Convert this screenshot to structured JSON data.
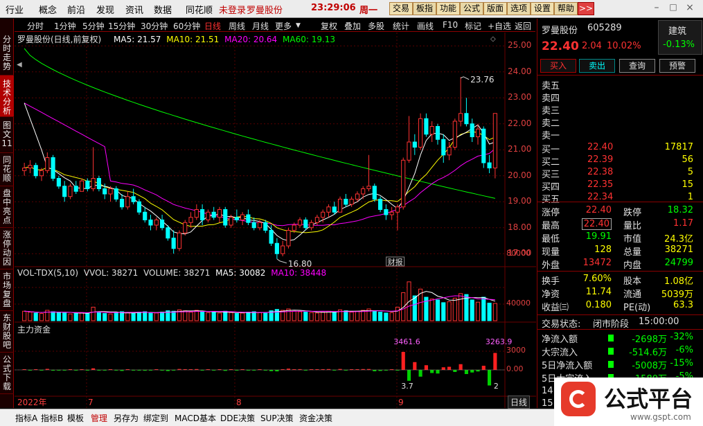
{
  "menu": {
    "items": [
      "行业",
      "概念",
      "前沿",
      "发现",
      "资讯",
      "数据",
      "同花顺"
    ],
    "login": "未登录",
    "stock": "罗曼股份",
    "time": "23:29:06",
    "weekday": "周一"
  },
  "win_buttons": [
    "交易",
    "板指",
    "功能",
    "公式",
    "版面",
    "选项",
    "设置",
    "帮助"
  ],
  "chart_toolbar": {
    "left": [
      "分时",
      "1分钟",
      "5分钟",
      "15分钟",
      "30分钟",
      "60分钟",
      "日线",
      "周线",
      "月线",
      "更多"
    ],
    "right": [
      "复权",
      "叠加",
      "多股",
      "统计",
      "画线",
      "F10",
      "标记",
      "+自选",
      "返回"
    ],
    "active": "日线"
  },
  "left_tabs": [
    "分时走势",
    "技术分析",
    "图文11",
    "同花顺",
    "盘中亮点",
    "涨停动因",
    "市场复盘",
    "东财股吧",
    "公式下载"
  ],
  "chart": {
    "header_name": "罗曼股份(日线,前复权)",
    "ma5": "MA5: 21.57",
    "ma10": "MA10: 21.51",
    "ma20": "MA20: 20.64",
    "ma60": "MA60: 19.13",
    "high_label": "23.76",
    "low_label": "16.80",
    "event_label": "财报",
    "vol_header": "VOL-TDX(5,10)",
    "vol_vvol": "VVOL: 38271",
    "vol_volume": "VOLUME: 38271",
    "vol_ma5": "MA5: 30082",
    "vol_ma10": "MA10: 38448",
    "zl_header": "主力资金",
    "zl_pos": "3461.6",
    "zl_pos2": "3263.9",
    "zl_neg": "3.7",
    "zl_neg2": "2",
    "dates": [
      "2022年",
      "7",
      "8",
      "9"
    ],
    "period_btn": "日线"
  },
  "chart_data": {
    "type": "candlestick",
    "title": "罗曼股份(日线,前复权)",
    "y_ticks": [
      "25.00",
      "24.00",
      "23.00",
      "22.00",
      "21.00",
      "20.00",
      "19.00",
      "18.00",
      "17.00"
    ],
    "vol_ticks": [
      "80000",
      "40000"
    ],
    "zl_ticks": [
      "3000",
      "0.00"
    ],
    "ylim": [
      16.5,
      25.3
    ],
    "ohlc": [
      [
        20.2,
        20.5,
        20.0,
        20.3
      ],
      [
        20.3,
        20.6,
        20.1,
        20.4
      ],
      [
        20.4,
        20.5,
        19.9,
        20.0
      ],
      [
        20.0,
        20.3,
        19.8,
        20.2
      ],
      [
        20.2,
        20.9,
        20.1,
        20.7
      ],
      [
        20.7,
        20.8,
        19.8,
        19.9
      ],
      [
        19.9,
        20.0,
        19.5,
        19.6
      ],
      [
        19.6,
        19.8,
        19.0,
        19.2
      ],
      [
        19.2,
        19.7,
        19.1,
        19.6
      ],
      [
        19.6,
        19.8,
        19.3,
        19.4
      ],
      [
        19.4,
        19.9,
        19.4,
        19.8
      ],
      [
        19.8,
        19.9,
        19.4,
        19.5
      ],
      [
        19.5,
        21.1,
        19.4,
        19.9
      ],
      [
        19.9,
        20.0,
        19.4,
        19.5
      ],
      [
        19.5,
        19.7,
        19.1,
        19.3
      ],
      [
        19.3,
        19.6,
        19.0,
        19.5
      ],
      [
        19.5,
        19.6,
        19.0,
        19.1
      ],
      [
        19.1,
        19.3,
        18.7,
        18.8
      ],
      [
        18.8,
        19.4,
        18.7,
        19.2
      ],
      [
        19.2,
        19.5,
        18.9,
        19.0
      ],
      [
        19.0,
        19.1,
        18.5,
        18.6
      ],
      [
        18.6,
        18.8,
        18.2,
        18.3
      ],
      [
        18.3,
        18.5,
        17.9,
        18.1
      ],
      [
        18.1,
        18.4,
        17.9,
        18.3
      ],
      [
        18.3,
        18.5,
        17.9,
        18.0
      ],
      [
        18.0,
        18.1,
        17.5,
        17.6
      ],
      [
        17.6,
        17.9,
        17.0,
        17.2
      ],
      [
        17.2,
        17.9,
        17.1,
        17.8
      ],
      [
        17.8,
        18.3,
        17.7,
        18.2
      ],
      [
        18.2,
        18.6,
        18.0,
        18.4
      ],
      [
        18.4,
        18.9,
        18.3,
        18.7
      ],
      [
        18.7,
        18.9,
        18.1,
        18.3
      ],
      [
        18.3,
        18.7,
        18.2,
        18.6
      ],
      [
        18.6,
        18.8,
        18.3,
        18.4
      ],
      [
        18.4,
        18.8,
        18.2,
        18.7
      ],
      [
        18.7,
        18.8,
        18.0,
        18.1
      ],
      [
        18.1,
        18.5,
        18.0,
        18.4
      ],
      [
        18.4,
        18.7,
        18.2,
        18.3
      ],
      [
        18.3,
        18.6,
        18.1,
        18.5
      ],
      [
        18.5,
        18.7,
        18.1,
        18.2
      ],
      [
        18.2,
        18.4,
        17.9,
        18.0
      ],
      [
        18.0,
        18.3,
        17.9,
        18.2
      ],
      [
        18.2,
        18.3,
        17.8,
        17.9
      ],
      [
        17.9,
        18.1,
        17.3,
        17.4
      ],
      [
        17.4,
        17.6,
        16.8,
        17.0
      ],
      [
        17.0,
        17.5,
        16.9,
        17.3
      ],
      [
        17.3,
        18.0,
        17.2,
        17.9
      ],
      [
        17.9,
        18.2,
        17.8,
        18.1
      ],
      [
        18.1,
        18.4,
        18.0,
        18.3
      ],
      [
        18.3,
        18.4,
        17.9,
        18.0
      ],
      [
        18.0,
        18.3,
        17.9,
        18.2
      ],
      [
        18.2,
        18.5,
        18.1,
        18.4
      ],
      [
        18.4,
        18.7,
        18.2,
        18.6
      ],
      [
        18.6,
        18.9,
        18.4,
        18.8
      ],
      [
        18.8,
        19.0,
        18.5,
        18.6
      ],
      [
        18.6,
        19.2,
        18.6,
        19.1
      ],
      [
        19.1,
        19.3,
        18.8,
        18.9
      ],
      [
        18.9,
        19.2,
        18.8,
        19.1
      ],
      [
        19.1,
        19.4,
        19.0,
        19.3
      ],
      [
        19.3,
        19.6,
        19.1,
        19.5
      ],
      [
        19.5,
        20.8,
        19.4,
        19.6
      ],
      [
        19.6,
        19.7,
        19.0,
        19.1
      ],
      [
        19.1,
        19.2,
        18.6,
        18.7
      ],
      [
        18.7,
        18.9,
        18.3,
        18.5
      ],
      [
        18.5,
        18.8,
        18.3,
        18.6
      ],
      [
        18.6,
        18.9,
        17.9,
        18.8
      ],
      [
        18.8,
        20.7,
        18.7,
        20.6
      ],
      [
        20.6,
        22.3,
        20.5,
        21.3
      ],
      [
        21.3,
        21.6,
        20.8,
        21.1
      ],
      [
        21.1,
        22.4,
        21.0,
        22.2
      ],
      [
        22.2,
        22.4,
        21.5,
        21.6
      ],
      [
        21.6,
        22.1,
        21.3,
        21.9
      ],
      [
        21.9,
        22.0,
        21.2,
        21.4
      ],
      [
        21.4,
        21.6,
        20.5,
        20.8
      ],
      [
        20.8,
        21.3,
        20.6,
        21.1
      ],
      [
        21.1,
        22.2,
        21.0,
        22.1
      ],
      [
        22.1,
        23.8,
        21.9,
        22.4
      ],
      [
        22.4,
        23.0,
        21.9,
        22.0
      ],
      [
        22.0,
        22.2,
        21.3,
        21.5
      ],
      [
        21.5,
        22.0,
        21.2,
        21.8
      ],
      [
        21.8,
        21.9,
        20.3,
        20.5
      ],
      [
        20.5,
        20.8,
        20.1,
        20.3
      ],
      [
        20.3,
        22.4,
        19.9,
        22.4
      ]
    ],
    "volumes": [
      21000,
      19000,
      17000,
      16000,
      23000,
      20000,
      18000,
      17000,
      15000,
      16000,
      18000,
      17000,
      30000,
      19000,
      16000,
      15000,
      17000,
      20000,
      18000,
      16000,
      19000,
      20000,
      18000,
      17000,
      19000,
      22000,
      21000,
      24000,
      22000,
      19000,
      23000,
      20000,
      18000,
      19000,
      17000,
      21000,
      18000,
      16000,
      17000,
      19000,
      20000,
      18000,
      17000,
      22000,
      25000,
      23000,
      26000,
      21000,
      20000,
      19000,
      18000,
      17000,
      19000,
      21000,
      20000,
      24000,
      22000,
      19000,
      21000,
      23000,
      26000,
      22000,
      19000,
      17000,
      18000,
      30000,
      62000,
      86000,
      55000,
      70000,
      52000,
      48000,
      46000,
      40000,
      42000,
      50000,
      60000,
      58000,
      46000,
      41000,
      52000,
      39000,
      38271
    ],
    "mainflow": [
      120,
      -80,
      60,
      -40,
      200,
      -150,
      -90,
      -60,
      80,
      -50,
      70,
      -30,
      300,
      -100,
      -60,
      50,
      -80,
      -200,
      120,
      -70,
      -110,
      -160,
      -90,
      60,
      -80,
      -220,
      -130,
      180,
      140,
      90,
      160,
      -120,
      80,
      -60,
      120,
      -180,
      70,
      -40,
      90,
      -80,
      -110,
      60,
      -90,
      -240,
      -280,
      130,
      240,
      110,
      150,
      -80,
      90,
      110,
      140,
      160,
      -70,
      180,
      -90,
      80,
      110,
      160,
      170,
      -260,
      -200,
      -90,
      60,
      -120,
      3461.6,
      -2100,
      1500,
      -1300,
      900,
      -600,
      -700,
      500,
      600,
      -400,
      1100,
      -800,
      -500,
      -300,
      800,
      -3000,
      3263.9
    ],
    "ma60": [
      null,
      null,
      null,
      null,
      null,
      null,
      null,
      null,
      null,
      null,
      null,
      null,
      null,
      null,
      null,
      null,
      null,
      null,
      null,
      null,
      null,
      null,
      null,
      null,
      null,
      null,
      null,
      null,
      null,
      null,
      null,
      null,
      null,
      null,
      null,
      null,
      null,
      null,
      null,
      null,
      null,
      null,
      null,
      null,
      null,
      null,
      null,
      null,
      null,
      null,
      null,
      null,
      null,
      null,
      null,
      null,
      null,
      null,
      null,
      null,
      null,
      null,
      null,
      null,
      null,
      null,
      null,
      null,
      null,
      null,
      null,
      null,
      null,
      null,
      null,
      null,
      null,
      null,
      null,
      null,
      null,
      null,
      19.13
    ],
    "xlabels": [
      "2022年",
      "7",
      "8",
      "9"
    ]
  },
  "quote": {
    "name": "罗曼股份",
    "code": "605289",
    "sector": "建筑",
    "sector_chg": "-0.13%",
    "price": "22.40",
    "chg": "2.04",
    "pct": "10.02%",
    "buttons": [
      "买入",
      "卖出",
      "查询",
      "预警"
    ],
    "sell_labels": [
      "卖五",
      "卖四",
      "卖三",
      "卖二",
      "卖一"
    ],
    "buy": [
      {
        "l": "买一",
        "p": "22.40",
        "v": "17817"
      },
      {
        "l": "买二",
        "p": "22.39",
        "v": "56"
      },
      {
        "l": "买三",
        "p": "22.38",
        "v": "5"
      },
      {
        "l": "买四",
        "p": "22.35",
        "v": "15"
      },
      {
        "l": "买五",
        "p": "22.34",
        "v": "1"
      }
    ],
    "stats": [
      {
        "l": "涨停",
        "v": "22.40",
        "l2": "跌停",
        "v2": "18.32"
      },
      {
        "l": "最高",
        "v": "22.40",
        "l2": "量比",
        "v2": "1.17"
      },
      {
        "l": "最低",
        "v": "19.91",
        "l2": "市值",
        "v2": "24.3亿"
      },
      {
        "l": "现量",
        "v": "128",
        "l2": "总量",
        "v2": "38271"
      },
      {
        "l": "外盘",
        "v": "13472",
        "l2": "内盘",
        "v2": "24799"
      }
    ],
    "stats2": [
      {
        "l": "换手",
        "v": "7.60%",
        "l2": "股本",
        "v2": "1.08亿"
      },
      {
        "l": "净资",
        "v": "11.74",
        "l2": "流通",
        "v2": "5039万"
      },
      {
        "l": "收益㈢",
        "v": "0.180",
        "l2": "PE(动)",
        "v2": "63.3"
      }
    ],
    "trade_state_label": "交易状态:",
    "trade_state": "闭市阶段",
    "trade_time": "15:00:00",
    "flows": [
      {
        "l": "净流入额",
        "v": "-2698万",
        "p": "-32%"
      },
      {
        "l": "大宗流入",
        "v": "-514.6万",
        "p": "-6%"
      },
      {
        "l": "5日净流入额",
        "v": "-5008万",
        "p": "-15%"
      },
      {
        "l": "5日大宗流入",
        "v": "-1580万",
        "p": "-5%"
      }
    ],
    "times": [
      "14:5",
      "15:0"
    ]
  },
  "bottom_tabs": [
    "指标A",
    "指标B",
    "模板",
    "管理",
    "另存为",
    "绑定到",
    "MACD基本",
    "DDE决策",
    "SUP决策",
    "资金决策"
  ],
  "logo": {
    "text": "公式平台",
    "url": "www.gspt.com"
  },
  "colors": {
    "up": "#ff3232",
    "down": "#00ffff",
    "ma5": "#ffffff",
    "ma10": "#ffff00",
    "ma20": "#ff00ff",
    "ma60": "#00ff00",
    "grid": "#6b0000"
  }
}
